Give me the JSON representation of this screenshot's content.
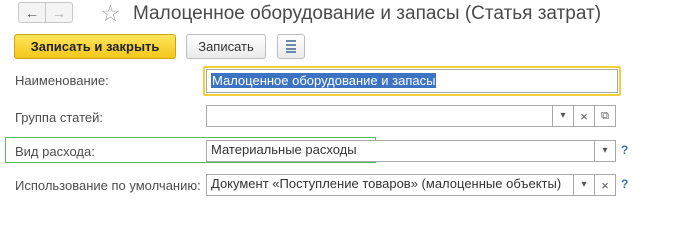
{
  "header": {
    "back_glyph": "←",
    "forward_glyph": "→",
    "star_glyph": "☆",
    "title": "Малоценное оборудование и запасы (Статья затрат)"
  },
  "toolbar": {
    "save_close_label": "Записать и закрыть",
    "save_label": "Записать",
    "report_icon": "document-list-icon"
  },
  "form": {
    "name": {
      "label": "Наименование:",
      "value": "Малоценное оборудование и запасы"
    },
    "group": {
      "label": "Группа статей:",
      "value": ""
    },
    "expense_type": {
      "label": "Вид расхода:",
      "value": "Материальные расходы",
      "help": "?"
    },
    "default_usage": {
      "label": "Использование по умолчанию:",
      "value": "Документ «Поступление товаров» (малоценные объекты)",
      "help": "?"
    },
    "dropdown_glyph": "▾",
    "clear_glyph": "×",
    "open_glyph": "⧉"
  },
  "colors": {
    "primary_button": "#f4c71a",
    "focus_outline": "#f5d03a",
    "highlight_outline": "#5cb85c",
    "selection": "#3c74c3",
    "help": "#3d6fb3"
  }
}
